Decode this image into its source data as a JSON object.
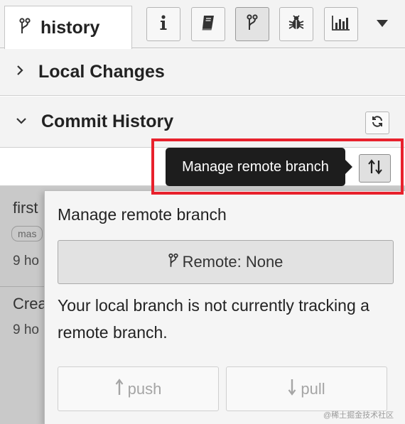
{
  "tabs": {
    "active_label": "history",
    "tools": [
      {
        "icon": "info-icon"
      },
      {
        "icon": "book-icon"
      },
      {
        "icon": "git-branch-icon"
      },
      {
        "icon": "bug-icon"
      },
      {
        "icon": "bar-chart-icon"
      }
    ]
  },
  "sections": {
    "local_changes": "Local Changes",
    "commit_history": "Commit History"
  },
  "commits": [
    {
      "message": "first",
      "branch": "mas",
      "time": "9 ho"
    },
    {
      "message": "Crea",
      "time": "9 ho"
    }
  ],
  "tooltip": "Manage remote branch",
  "popover": {
    "title": "Manage remote branch",
    "remote_button": "Remote: None",
    "message": "Your local branch is not currently tracking a remote branch.",
    "push_label": "push",
    "pull_label": "pull"
  },
  "watermark": "@稀土掘金技术社区",
  "colors": {
    "highlight": "#e8212c",
    "tooltip_bg": "#1d1d1d",
    "panel_bg": "#f3f3f3"
  }
}
